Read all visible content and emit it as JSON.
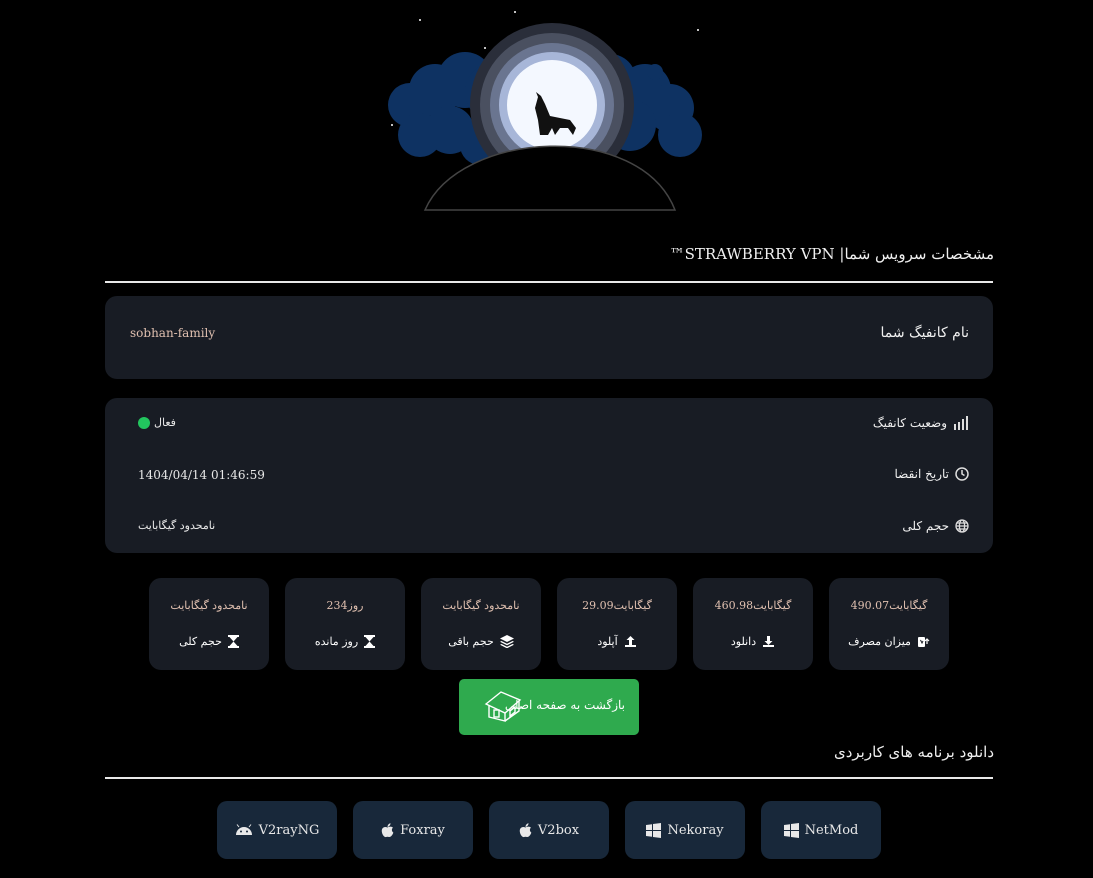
{
  "header": {
    "title": "مشخصات سرویس شما| STRAWBERRY VPN™"
  },
  "config": {
    "name_label": "نام کانفیگ شما",
    "name_value": "sobhan-family"
  },
  "details": {
    "status_label": "وضعیت کانفیگ",
    "status_value": "فعال",
    "status_color": "#22c55e",
    "expiry_label": "تاریخ انقضا",
    "expiry_value": "1404/04/14 01:46:59",
    "total_label": "حجم کلی",
    "total_value": "نامحدود گیگابایت"
  },
  "stats": [
    {
      "value": "490.07گیگابایت",
      "label": "میزان مصرف",
      "icon": "usage-icon"
    },
    {
      "value": "460.98گیگابایت",
      "label": "دانلود",
      "icon": "download-icon"
    },
    {
      "value": "29.09گیگابایت",
      "label": "آپلود",
      "icon": "upload-icon"
    },
    {
      "value": "نامحدود گیگابایت",
      "label": "حجم باقی",
      "icon": "layers-icon"
    },
    {
      "value": "234روز",
      "label": "روز مانده",
      "icon": "hourglass-icon"
    },
    {
      "value": "نامحدود گیگابایت",
      "label": "حجم کلی",
      "icon": "hourglass-icon"
    }
  ],
  "back_button": {
    "label": "بازگشت به صفحه اصلی",
    "icon": "house-icon"
  },
  "apps_section": {
    "title": "دانلود برنامه های کاربردی"
  },
  "apps": [
    {
      "label": "V2rayNG",
      "icon": "android-icon"
    },
    {
      "label": "Foxray",
      "icon": "apple-icon"
    },
    {
      "label": "V2box",
      "icon": "apple-icon"
    },
    {
      "label": "Nekoray",
      "icon": "windows-icon"
    },
    {
      "label": "NetMod",
      "icon": "windows-icon"
    }
  ],
  "colors": {
    "accent": "#2faa4e",
    "card": "#181c24",
    "app_card": "#18283a"
  }
}
